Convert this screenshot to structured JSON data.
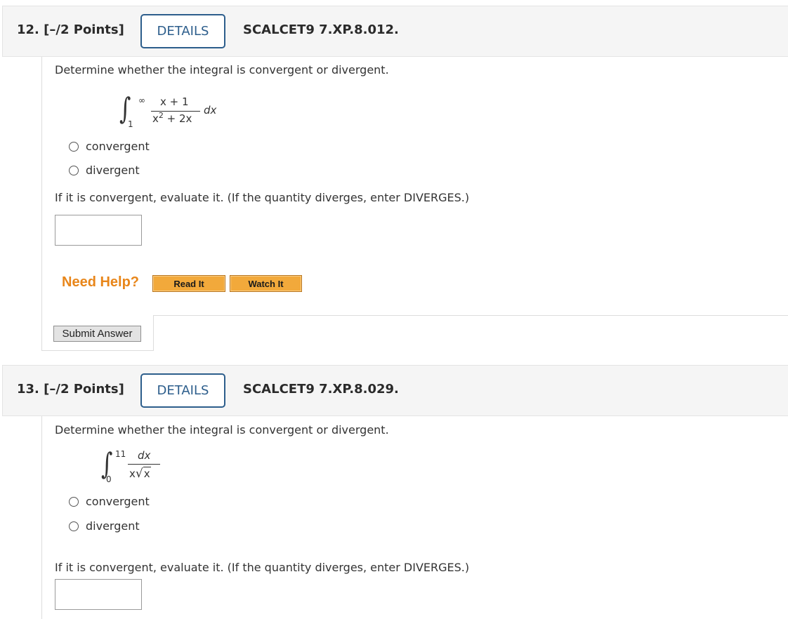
{
  "questions": [
    {
      "number_points": "12. [–/2 Points]",
      "details_label": "DETAILS",
      "code": "SCALCET9 7.XP.8.012.",
      "prompt": "Determine whether the integral is convergent or divergent.",
      "integral": {
        "lower": "1",
        "upper": "∞",
        "numerator": "x + 1",
        "denominator_x": "x",
        "denominator_exp": "2",
        "denominator_rest": " + 2x",
        "differential": "dx"
      },
      "options": [
        "convergent",
        "divergent"
      ],
      "evaluate_prompt": "If it is convergent, evaluate it. (If the quantity diverges, enter DIVERGES.)",
      "answer_value": "",
      "need_help_label": "Need Help?",
      "read_it_label": "Read It",
      "watch_it_label": "Watch It",
      "submit_label": "Submit Answer"
    },
    {
      "number_points": "13. [–/2 Points]",
      "details_label": "DETAILS",
      "code": "SCALCET9 7.XP.8.029.",
      "prompt": "Determine whether the integral is convergent or divergent.",
      "integral": {
        "lower": "0",
        "upper": "11",
        "numerator": "dx",
        "denominator_x": "x",
        "denominator_root": "x"
      },
      "options": [
        "convergent",
        "divergent"
      ],
      "evaluate_prompt": "If it is convergent, evaluate it. (If the quantity diverges, enter DIVERGES.)",
      "answer_value": ""
    }
  ],
  "colors": {
    "details_border": "#2d5e8c",
    "need_help": "#e8861a",
    "help_button": "#f2a93b"
  }
}
